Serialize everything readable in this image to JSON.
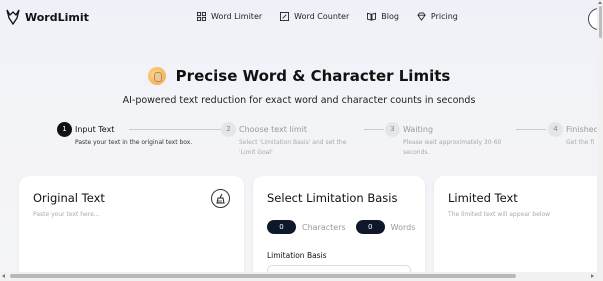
{
  "brand": {
    "name": "WordLimit",
    "icon": "wolf-logo-icon"
  },
  "nav": {
    "links": [
      {
        "label": "Word Limiter",
        "icon": "grid-icon"
      },
      {
        "label": "Word Counter",
        "icon": "edit-box-icon"
      },
      {
        "label": "Blog",
        "icon": "open-book-icon"
      },
      {
        "label": "Pricing",
        "icon": "diamond-icon"
      }
    ]
  },
  "hero": {
    "title": "Precise Word & Character Limits",
    "subtitle": "AI-powered text reduction for exact word and character counts in seconds",
    "emoji_icon": "waving-hand-icon"
  },
  "steps": [
    {
      "number": "1",
      "title": "Input Text",
      "description": [
        "Paste your text in the original text box."
      ],
      "active": true
    },
    {
      "number": "2",
      "title": "Choose text limit",
      "description": [
        "Select 'Limitation Basis' and set the",
        "'Limit Goal'"
      ],
      "active": false
    },
    {
      "number": "3",
      "title": "Waiting",
      "description": [
        "Please wait approximately 30-60",
        "seconds."
      ],
      "active": false
    },
    {
      "number": "4",
      "title": "Finished",
      "description": [
        "Get the fi"
      ],
      "active": false
    }
  ],
  "original": {
    "title": "Original Text",
    "placeholder": "Paste your text here...",
    "clear_icon": "broom-icon"
  },
  "limitation": {
    "title": "Select Limitation Basis",
    "characters_count": "0",
    "characters_label": "Characters",
    "words_count": "0",
    "words_label": "Words",
    "basis_label": "Limitation Basis"
  },
  "limited": {
    "title": "Limited Text",
    "placeholder": "The limited text will appear below"
  },
  "colors": {
    "accent_dark": "#0f172a",
    "muted": "#999999"
  }
}
